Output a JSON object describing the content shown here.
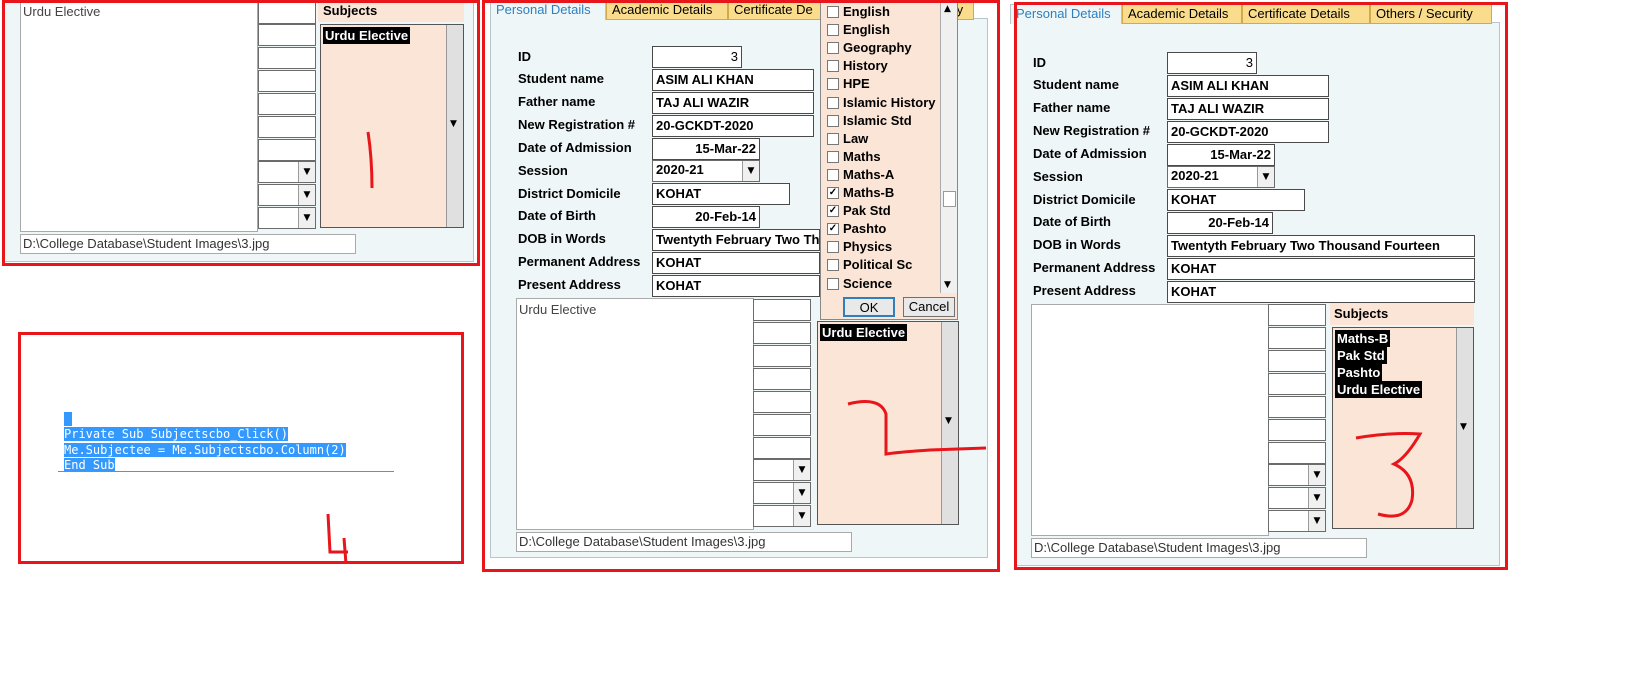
{
  "panel1": {
    "list_text": "Urdu Elective",
    "subjects_header": "Subjects",
    "subjects_selected": [
      "Urdu Elective"
    ],
    "image_path": "D:\\College Database\\Student Images\\3.jpg",
    "annotation": "1"
  },
  "panel2": {
    "tabs": [
      "Personal Details",
      "Academic Details",
      "Certificate De",
      "ty"
    ],
    "labels": {
      "id": "ID",
      "name": "Student name",
      "father": "Father name",
      "reg": "New Registration #",
      "doa": "Date of Admission",
      "session": "Session",
      "domicile": "District Domicile",
      "dob": "Date of Birth",
      "dob_words": "DOB in Words",
      "perm": "Permanent Address",
      "present": "Present Address"
    },
    "values": {
      "id": "3",
      "name": "ASIM ALI KHAN",
      "father": "TAJ ALI WAZIR",
      "reg": "20-GCKDT-2020",
      "doa": "15-Mar-22",
      "session": "2020-21",
      "domicile": "KOHAT",
      "dob": "20-Feb-14",
      "dob_words": "Twentyth February Two Tho",
      "perm": "KOHAT",
      "present": "KOHAT"
    },
    "list_text": "Urdu Elective",
    "subjects_selected": [
      "Urdu Elective"
    ],
    "image_path": "D:\\College Database\\Student Images\\3.jpg",
    "dropdown": {
      "items": [
        {
          "label": "English",
          "checked": false
        },
        {
          "label": "English",
          "checked": false
        },
        {
          "label": "Geography",
          "checked": false
        },
        {
          "label": "History",
          "checked": false
        },
        {
          "label": "HPE",
          "checked": false
        },
        {
          "label": "Islamic History",
          "checked": false
        },
        {
          "label": "Islamic Std",
          "checked": false
        },
        {
          "label": "Law",
          "checked": false
        },
        {
          "label": "Maths",
          "checked": false
        },
        {
          "label": "Maths-A",
          "checked": false
        },
        {
          "label": "Maths-B",
          "checked": true
        },
        {
          "label": "Pak Std",
          "checked": true
        },
        {
          "label": "Pashto",
          "checked": true
        },
        {
          "label": "Physics",
          "checked": false
        },
        {
          "label": "Political Sc",
          "checked": false
        },
        {
          "label": "Science",
          "checked": false
        }
      ],
      "ok": "OK",
      "cancel": "Cancel"
    },
    "annotation": "2"
  },
  "panel3": {
    "tabs": [
      "Personal Details",
      "Academic Details",
      "Certificate Details",
      "Others / Security"
    ],
    "labels": {
      "id": "ID",
      "name": "Student name",
      "father": "Father name",
      "reg": "New Registration #",
      "doa": "Date of Admission",
      "session": "Session",
      "domicile": "District Domicile",
      "dob": "Date of Birth",
      "dob_words": "DOB in Words",
      "perm": "Permanent Address",
      "present": "Present Address"
    },
    "values": {
      "id": "3",
      "name": "ASIM ALI KHAN",
      "father": "TAJ ALI WAZIR",
      "reg": "20-GCKDT-2020",
      "doa": "15-Mar-22",
      "session": "2020-21",
      "domicile": "KOHAT",
      "dob": "20-Feb-14",
      "dob_words": "Twentyth February Two Thousand Fourteen",
      "perm": "KOHAT",
      "present": "KOHAT"
    },
    "subjects_header": "Subjects",
    "subjects_selected": [
      "Maths-B",
      "Pak Std",
      "Pashto",
      "Urdu Elective"
    ],
    "image_path": "D:\\College Database\\Student Images\\3.jpg",
    "annotation": "3"
  },
  "panel4": {
    "code_lines": [
      "Private Sub Subjectscbo_Click()",
      "Me.Subjectee = Me.Subjectscbo.Column(2)",
      "End Sub"
    ],
    "annotation": "4"
  },
  "colors": {
    "red": "#e8151b",
    "tab": "#fadd8c",
    "panel": "#eef6f8",
    "listbox": "#fbe5d6",
    "code_sel": "#3399ff"
  }
}
